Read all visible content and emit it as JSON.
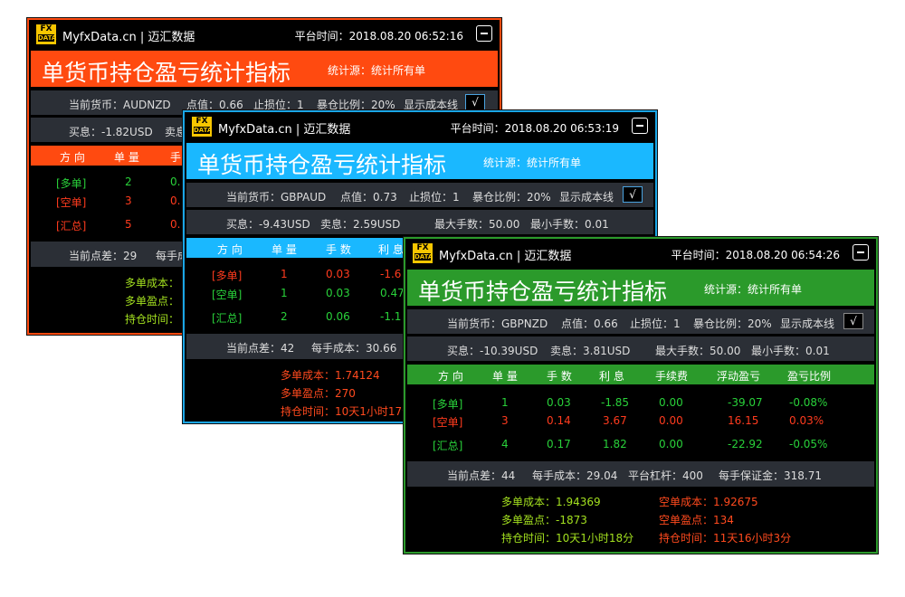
{
  "brand": "MyfxData.cn | 迈汇数据",
  "logo": {
    "top": "FX",
    "bottom": "DATA"
  },
  "title": "单货币持仓盈亏统计指标",
  "subtitle": "统计源：统计所有单",
  "check_mark": "√",
  "colors": {
    "orange": "#ff4a10",
    "blue": "#1ab8ff",
    "green": "#2b9a2b"
  },
  "panel1": {
    "time": "平台时间：2018.08.20 06:52:16",
    "info1": {
      "currency": "当前货币：AUDNZD",
      "point": "点值：0.66",
      "stop": "止损位：1",
      "ratio": "暴仓比例：20%",
      "show": "显示成本线"
    },
    "info2": {
      "buy": "买息：-1.82USD",
      "sell": "卖息"
    },
    "headers": [
      "方 向",
      "单 量",
      "手"
    ],
    "rows": [
      {
        "dir": "[多单]",
        "qty": "2",
        "lots": "0."
      },
      {
        "dir": "[空单]",
        "qty": "3",
        "lots": "0."
      },
      {
        "dir": "[汇总]",
        "qty": "5",
        "lots": "0."
      }
    ],
    "foot": {
      "spread": "当前点差：29",
      "cost": "每手成"
    },
    "bottom": [
      "多单成本：",
      "多单盈点：",
      "持仓时间："
    ]
  },
  "panel2": {
    "time": "平台时间：2018.08.20 06:53:19",
    "info1": {
      "currency": "当前货币：GBPAUD",
      "point": "点值：0.73",
      "stop": "止损位：1",
      "ratio": "暴仓比例：20%",
      "show": "显示成本线"
    },
    "info2": {
      "buy": "买息：-9.43USD",
      "sell": "卖息：2.59USD",
      "max": "最大手数：50.00",
      "min": "最小手数：0.01"
    },
    "headers": [
      "方 向",
      "单 量",
      "手 数",
      "利 息"
    ],
    "rows": [
      {
        "dir": "[多单]",
        "qty": "1",
        "lots": "0.03",
        "swap": "-1.6"
      },
      {
        "dir": "[空单]",
        "qty": "1",
        "lots": "0.03",
        "swap": "0.47"
      },
      {
        "dir": "[汇总]",
        "qty": "2",
        "lots": "0.06",
        "swap": "-1.1"
      }
    ],
    "foot": {
      "spread": "当前点差：42",
      "cost": "每手成本：30.66"
    },
    "bottom": [
      "多单成本：1.74124",
      "多单盈点：270",
      "持仓时间：10天1小时17分"
    ]
  },
  "panel3": {
    "time": "平台时间：2018.08.20 06:54:26",
    "info1": {
      "currency": "当前货币：GBPNZD",
      "point": "点值：0.66",
      "stop": "止损位：1",
      "ratio": "暴仓比例：20%",
      "show": "显示成本线"
    },
    "info2": {
      "buy": "买息：-10.39USD",
      "sell": "卖息：3.81USD",
      "max": "最大手数：50.00",
      "min": "最小手数：0.01"
    },
    "headers": [
      "方 向",
      "单 量",
      "手 数",
      "利 息",
      "手续费",
      "浮动盈亏",
      "盈亏比例"
    ],
    "rows": [
      {
        "dir": "[多单]",
        "qty": "1",
        "lots": "0.03",
        "swap": "-1.85",
        "fee": "0.00",
        "pl": "-39.07",
        "ratio": "-0.08%"
      },
      {
        "dir": "[空单]",
        "qty": "3",
        "lots": "0.14",
        "swap": "3.67",
        "fee": "0.00",
        "pl": "16.15",
        "ratio": "0.03%"
      },
      {
        "dir": "[汇总]",
        "qty": "4",
        "lots": "0.17",
        "swap": "1.82",
        "fee": "0.00",
        "pl": "-22.92",
        "ratio": "-0.05%"
      }
    ],
    "foot": {
      "spread": "当前点差：44",
      "cost": "每手成本：29.04",
      "leverage": "平台杠杆：400",
      "margin": "每手保证金：318.71"
    },
    "bottom_left": [
      "多单成本：1.94369",
      "多单盈点：-1873",
      "持仓时间：10天1小时18分"
    ],
    "bottom_right": [
      "空单成本：1.92675",
      "空单盈点：134",
      "持仓时间：11天16小时3分"
    ]
  }
}
